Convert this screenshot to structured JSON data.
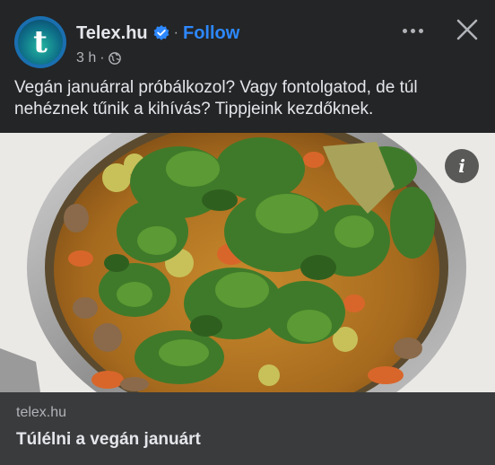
{
  "post": {
    "page_name": "Telex.hu",
    "avatar_letter": "t",
    "follow_label": "Follow",
    "separator_dot": "·",
    "time": "3 h",
    "meta_dot": "·",
    "caption": "Vegán januárral próbálkozol? Vagy fontolgatod, de túl nehéznek tűnik a kihívás? Tippjeink kezdőknek."
  },
  "image": {
    "info_label": "i"
  },
  "link_card": {
    "domain": "telex.hu",
    "title": "Túlélni a vegán januárt"
  },
  "colors": {
    "background": "#242526",
    "accent": "#2d88ff",
    "link_card_bg": "#3a3b3c"
  },
  "icons": [
    "verified-badge-icon",
    "globe-icon",
    "more-options-icon",
    "close-icon",
    "info-icon"
  ]
}
